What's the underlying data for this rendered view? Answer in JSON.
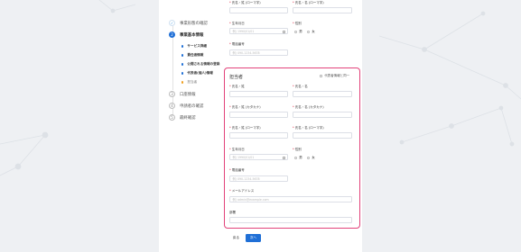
{
  "stepper": {
    "steps": [
      {
        "num": "✓",
        "label": "事業形態の確認"
      },
      {
        "num": "2",
        "label": "事業基本情報"
      },
      {
        "num": "3",
        "label": "口座情報"
      },
      {
        "num": "4",
        "label": "申請者の確認"
      },
      {
        "num": "5",
        "label": "最終確認"
      }
    ],
    "substeps": [
      "サービス詳細",
      "責任者情報",
      "公開される情報の登録",
      "代表者(個人)情報",
      "担当者"
    ]
  },
  "top_form": {
    "name_roman_last_label": "氏名・姓 (ローマ字)",
    "name_roman_first_label": "氏名・名 (ローマ字)",
    "birthdate_label": "生年月日",
    "birthdate_placeholder": "例) 1990/01/01",
    "gender_label": "性別",
    "gender_male": "男",
    "gender_female": "女",
    "phone_label": "電話番号",
    "phone_placeholder": "例) 090-1234-5678"
  },
  "contact_section": {
    "title": "担当者",
    "same_as_rep": "代表者情報と同一",
    "last_name_label": "氏名・姓",
    "first_name_label": "氏名・名",
    "last_kana_label": "氏名・姓 (カタカナ)",
    "first_kana_label": "氏名・名 (カタカナ)",
    "last_roman_label": "氏名・姓 (ローマ字)",
    "first_roman_label": "氏名・名 (ローマ字)",
    "birthdate_label": "生年月日",
    "birthdate_placeholder": "例) 1990/01/01",
    "gender_label": "性別",
    "gender_male": "男",
    "gender_female": "女",
    "phone_label": "電話番号",
    "phone_placeholder": "例) 090-1234-5678",
    "email_label": "メールアドレス",
    "email_placeholder": "例) admin@example.com",
    "position_label": "部署"
  },
  "buttons": {
    "back": "戻る",
    "next": "次へ"
  },
  "required_mark": "*",
  "colors": {
    "accent": "#1f6fd6",
    "highlight": "#e2427a",
    "required": "#e0304a"
  }
}
